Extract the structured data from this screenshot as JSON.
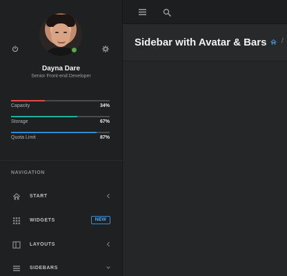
{
  "profile": {
    "name": "Dayna Dare",
    "role": "Senior Front-end Developer",
    "status_color": "#5aa845"
  },
  "stats": [
    {
      "label": "Capacity",
      "value": "34%",
      "percent": 34,
      "color": "#e24b4b"
    },
    {
      "label": "Storage",
      "value": "67%",
      "percent": 67,
      "color": "#20b2a1"
    },
    {
      "label": "Quota Limit",
      "value": "87%",
      "percent": 87,
      "color": "#2f8ad6"
    }
  ],
  "navigation": {
    "title": "NAVIGATION",
    "items": [
      {
        "label": "START",
        "icon": "home-icon"
      },
      {
        "label": "WIDGETS",
        "icon": "grid-icon",
        "badge": "NEW"
      },
      {
        "label": "LAYOUTS",
        "icon": "layout-icon"
      },
      {
        "label": "SIDEBARS",
        "icon": "list-icon"
      }
    ]
  },
  "topbar": {
    "menu_icon": "menu-icon",
    "search_icon": "search-icon"
  },
  "header": {
    "title": "Sidebar with Avatar & Bars",
    "breadcrumb_separator": "/"
  },
  "colors": {
    "accent": "#3b8fd6",
    "sidebar_bg": "#1f2021",
    "content_bg": "#252627"
  }
}
